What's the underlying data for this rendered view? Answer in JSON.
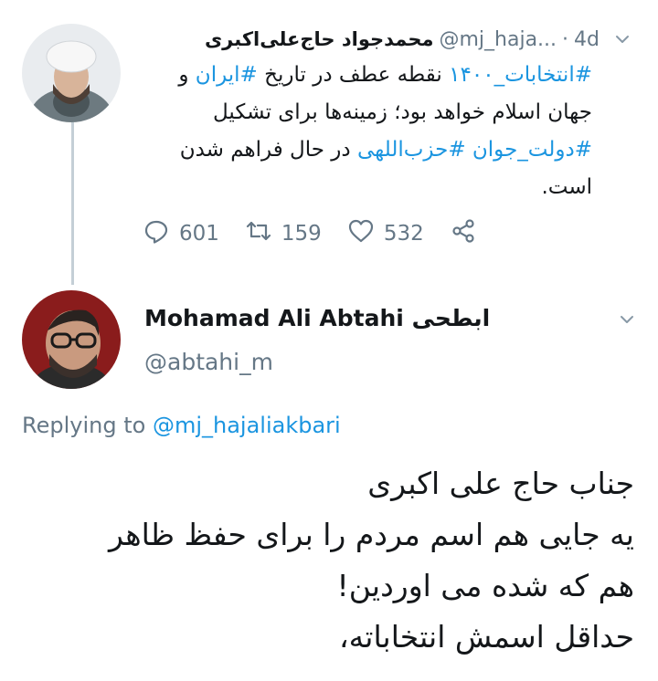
{
  "tweet1": {
    "display_name": "محمدجواد حاج‌علی‌اکبری",
    "handle": "@mj_haja...",
    "separator": "·",
    "time": "4d",
    "body": {
      "tag_elections": "#انتخابات_۱۴۰۰",
      "text_1": " نقطه عطف در تاریخ ",
      "tag_iran": "#ایران",
      "text_2": " و جهان اسلام خواهد بود؛ زمینه‌ها برای تشکیل ",
      "tag_young_gov": "#دولت_جوان",
      "text_3": " ",
      "tag_hezbollahi": "#حزب‌اللهی",
      "text_4": " در حال فراهم شدن است."
    },
    "actions": {
      "reply_count": "601",
      "retweet_count": "159",
      "like_count": "532"
    },
    "icons": {
      "menu": "chevron-down-icon",
      "reply": "reply-icon",
      "retweet": "retweet-icon",
      "like": "heart-icon",
      "share": "share-icon"
    }
  },
  "tweet2": {
    "display_name": "Mohamad Ali Abtahi ابطحی",
    "handle": "@abtahi_m",
    "replying_prefix": "Replying to",
    "replying_to": "@mj_hajaliakbari",
    "body_lines": [
      "جناب حاج علی اکبری",
      "یه جایی هم اسم مردم را برای حفظ ظاهر",
      "هم که شده می اوردین!",
      "حداقل اسمش انتخاباته،"
    ]
  },
  "colors": {
    "text": "#14171a",
    "secondary": "#657786",
    "link": "#1b95e0",
    "thread_line": "#c4cfd6"
  }
}
